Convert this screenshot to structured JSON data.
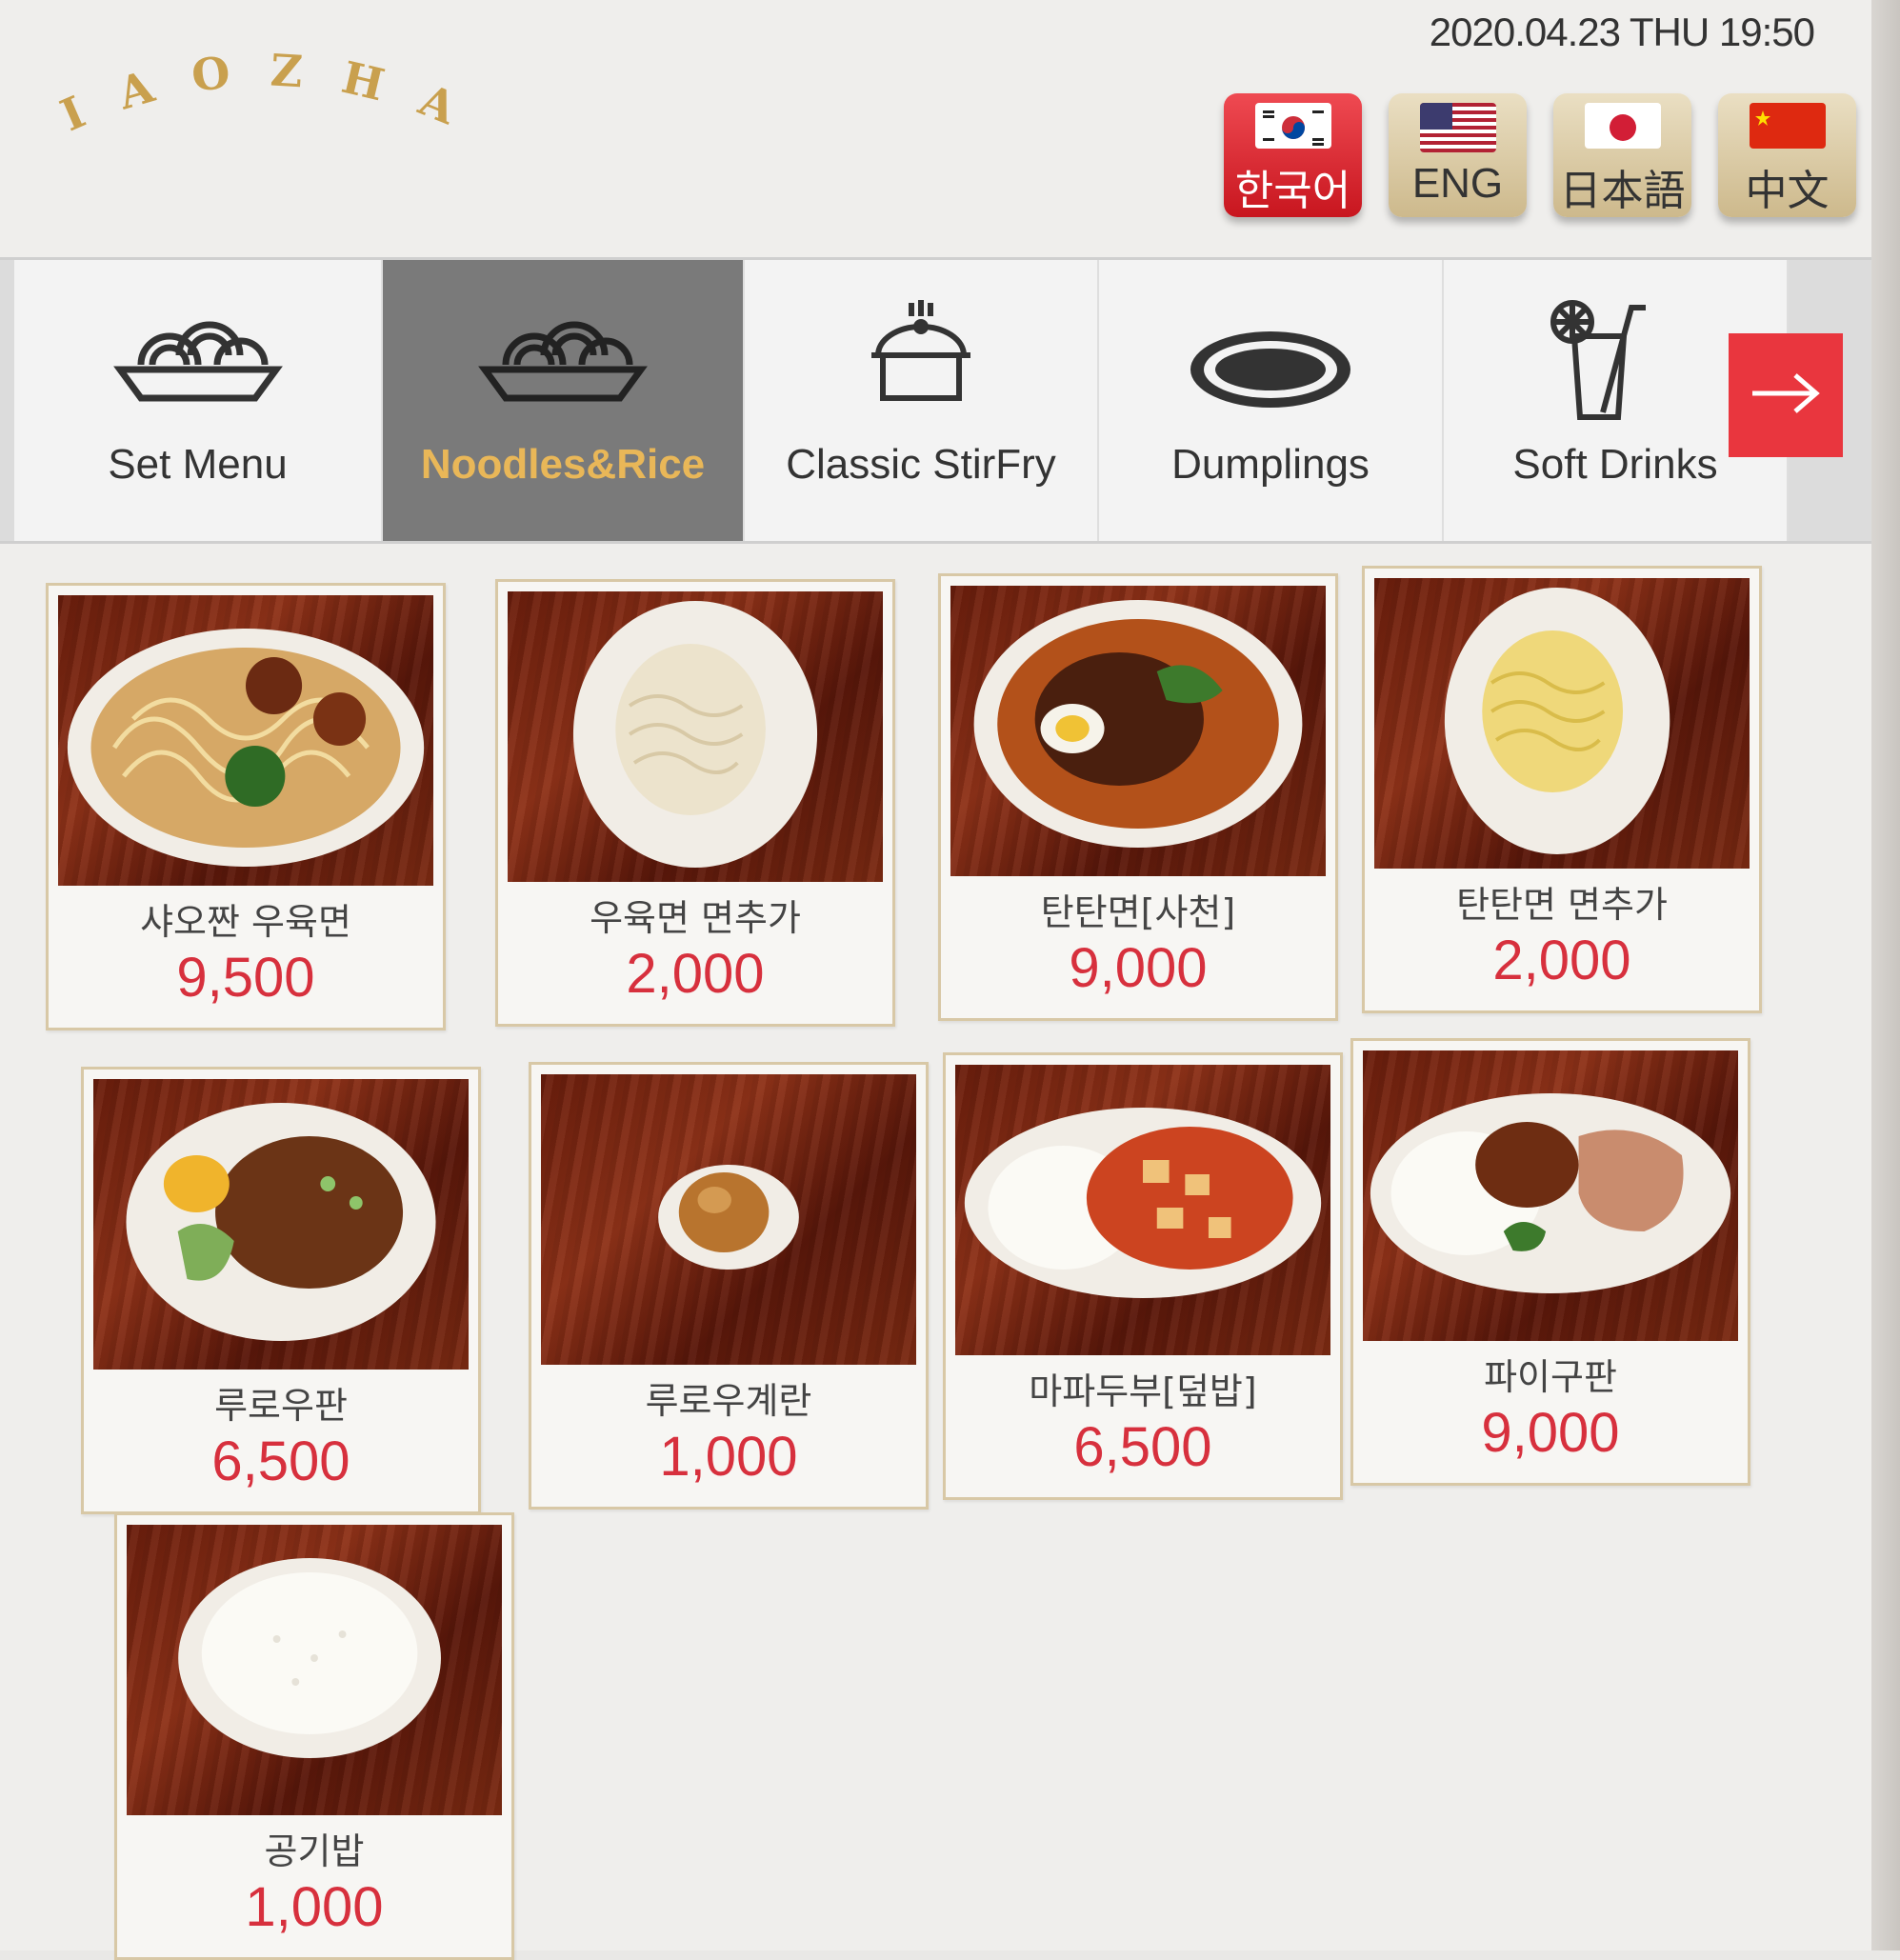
{
  "header": {
    "logo_text": ". X I A O  Z H A N .",
    "datetime": "2020.04.23 THU 19:50"
  },
  "languages": [
    {
      "label": "한국어",
      "flag": "korea-flag",
      "active": true
    },
    {
      "label": "ENG",
      "flag": "usa-flag",
      "active": false
    },
    {
      "label": "日本語",
      "flag": "japan-flag",
      "active": false
    },
    {
      "label": "中文",
      "flag": "china-flag",
      "active": false
    }
  ],
  "categories": [
    {
      "label": "Set Menu",
      "icon": "noodle-bowl-icon",
      "active": false
    },
    {
      "label": "Noodles&Rice",
      "icon": "noodle-bowl-icon",
      "active": true
    },
    {
      "label": "Classic StirFry",
      "icon": "pot-icon",
      "active": false
    },
    {
      "label": "Dumplings",
      "icon": "plate-icon",
      "active": false
    },
    {
      "label": "Soft Drinks",
      "icon": "drink-icon",
      "active": false
    }
  ],
  "next_icon": "arrow-right-icon",
  "items": [
    {
      "name": "샤오짠 우육면",
      "price": "9,500",
      "dish": "beef-noodle-soup"
    },
    {
      "name": "우육면 면추가",
      "price": "2,000",
      "dish": "plain-noodles"
    },
    {
      "name": "탄탄면[사천]",
      "price": "9,000",
      "dish": "dandan-noodles"
    },
    {
      "name": "탄탄면 면추가",
      "price": "2,000",
      "dish": "yellow-noodles"
    },
    {
      "name": "루로우판",
      "price": "6,500",
      "dish": "braised-pork-rice"
    },
    {
      "name": "루로우계란",
      "price": "1,000",
      "dish": "braised-egg"
    },
    {
      "name": "마파두부[덮밥]",
      "price": "6,500",
      "dish": "mapo-tofu-rice"
    },
    {
      "name": "파이구판",
      "price": "9,000",
      "dish": "pork-chop-rice"
    },
    {
      "name": "공기밥",
      "price": "1,000",
      "dish": "steamed-rice"
    }
  ],
  "colors": {
    "accent_red": "#e9363e",
    "price_red": "#d7303d",
    "active_category_bg": "#7a7a7a",
    "active_category_text": "#e9b758",
    "card_border": "#d8c8a6"
  }
}
